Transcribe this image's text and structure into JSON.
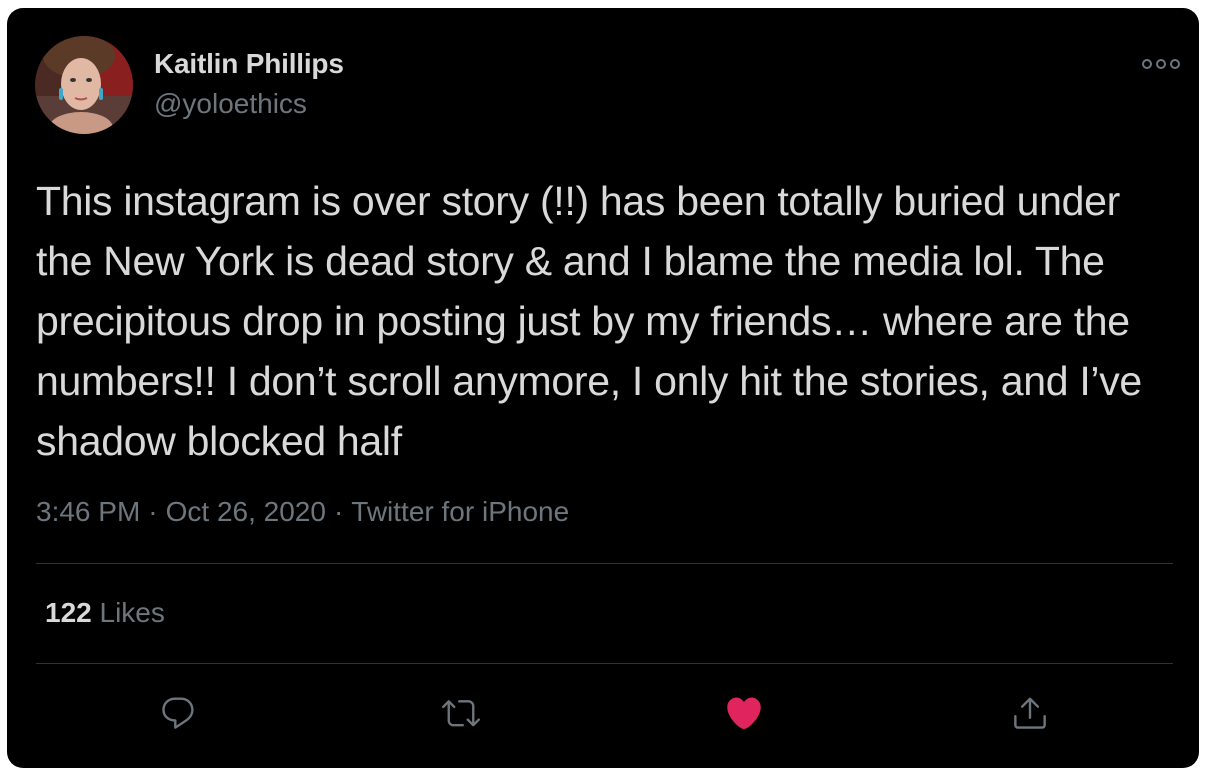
{
  "author": {
    "name": "Kaitlin Phillips",
    "handle": "@yoloethics"
  },
  "tweet": {
    "text": "This instagram is over story (!!) has been totally buried under the New York is dead story & and I blame the media lol. The precipitous drop in posting just by my friends… where are the numbers!! I don’t scroll anymore, I only hit the stories, and I’ve shadow blocked half",
    "time": "3:46 PM",
    "date": "Oct 26, 2020",
    "separator": "·",
    "source": "Twitter for iPhone"
  },
  "stats": {
    "likes_count": "122",
    "likes_label": "Likes"
  },
  "actions": {
    "reply_icon": "reply-icon",
    "retweet_icon": "retweet-icon",
    "like_icon": "heart-icon",
    "share_icon": "share-icon"
  },
  "colors": {
    "background": "#000000",
    "text": "#d9d9d9",
    "secondary": "#6e767d",
    "divider": "#2f3336",
    "like": "#e0245e"
  }
}
